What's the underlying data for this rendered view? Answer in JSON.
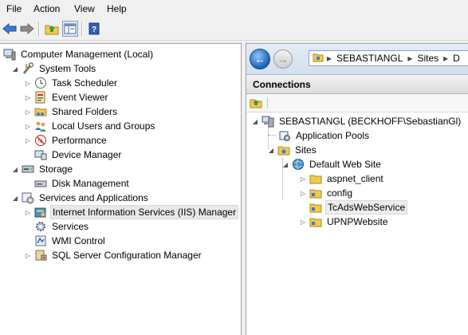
{
  "menu": [
    "File",
    "Action",
    "View",
    "Help"
  ],
  "left_tree": {
    "root": "Computer Management (Local)",
    "system_tools": "System Tools",
    "task_scheduler": "Task Scheduler",
    "event_viewer": "Event Viewer",
    "shared_folders": "Shared Folders",
    "local_users": "Local Users and Groups",
    "performance": "Performance",
    "device_manager": "Device Manager",
    "storage": "Storage",
    "disk_management": "Disk Management",
    "services_apps": "Services and Applications",
    "iis_manager": "Internet Information Services (IIS) Manager",
    "services": "Services",
    "wmi_control": "WMI Control",
    "sql_config": "SQL Server Configuration Manager"
  },
  "address": {
    "seg1": "SEBASTIANGL",
    "seg2": "Sites",
    "seg3": "D"
  },
  "connections": {
    "header": "Connections",
    "server": "SEBASTIANGL (BECKHOFF\\SebastianGl)",
    "app_pools": "Application Pools",
    "sites": "Sites",
    "default_site": "Default Web Site",
    "aspnet_client": "aspnet_client",
    "config": "config",
    "tcads": "TcAdsWebService",
    "upnp": "UPNPWebsite"
  },
  "icons": {
    "back": "back-arrow-icon",
    "forward": "forward-arrow-icon",
    "up": "up-folder-icon",
    "show_hide": "show-hide-tree-icon",
    "help": "help-icon"
  }
}
